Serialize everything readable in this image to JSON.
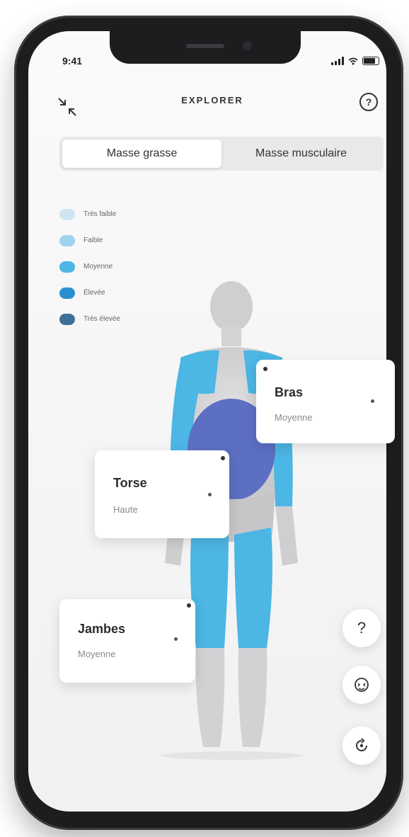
{
  "status": {
    "time": "9:41"
  },
  "header": {
    "title": "EXPLORER",
    "help": "?"
  },
  "segments": [
    {
      "label": "Masse grasse",
      "active": true
    },
    {
      "label": "Masse musculaire",
      "active": false
    }
  ],
  "legend": [
    {
      "label": "Très faible",
      "color": "#cfe6f2"
    },
    {
      "label": "Faible",
      "color": "#9dd3ee"
    },
    {
      "label": "Moyenne",
      "color": "#4cb6e4"
    },
    {
      "label": "Élevée",
      "color": "#2a8fd0"
    },
    {
      "label": "Très élevée",
      "color": "#3f6f97"
    }
  ],
  "cards": {
    "bras": {
      "title": "Bras",
      "subtitle": "Moyenne"
    },
    "torse": {
      "title": "Torse",
      "subtitle": "Haute"
    },
    "jambes": {
      "title": "Jambes",
      "subtitle": "Moyenne"
    }
  },
  "fabs": {
    "help": "?"
  },
  "icons": {
    "collapse": "collapse-arrows-icon",
    "help": "question-circle-icon",
    "face": "face-scan-icon",
    "rotate": "rotate-icon"
  },
  "colors": {
    "fat_light": "#4cb6e4",
    "fat_dark": "#5c6fc2",
    "body_gray": "#cfcfd2"
  }
}
